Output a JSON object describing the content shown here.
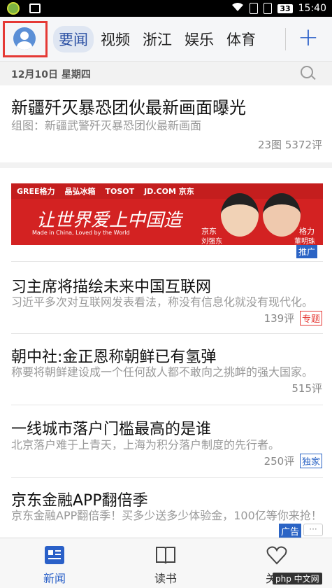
{
  "status_bar": {
    "battery": "33",
    "time": "15:40"
  },
  "tabs": [
    "要闻",
    "视频",
    "浙江",
    "娱乐",
    "体育"
  ],
  "date_line": "12月10日 星期四",
  "featured": {
    "title": "新疆歼灭暴恐团伙最新画面曝光",
    "subtitle": "组图：新疆武警歼灭暴恐团伙最新画面",
    "meta": "23图  5372评"
  },
  "ad": {
    "brands": [
      "GREE格力",
      "晶弘冰箱",
      "TOSOT",
      "JD.COM 京东"
    ],
    "slogan": "让世界爱上中国造",
    "tagline": "Made in China, Loved by the World",
    "person1_title": "京东",
    "person1_name": "刘强东",
    "person2_title": "格力",
    "person2_name": "董明珠",
    "tag": "推广"
  },
  "news": [
    {
      "title": "习主席将描绘未来中国互联网",
      "summary": "习近平多次对互联网发表看法，称没有信息化就没有现代化。",
      "comments": "139评",
      "badge": "专题"
    },
    {
      "title": "朝中社:金正恩称朝鲜已有氢弹",
      "summary": "称要将朝鲜建设成一个任何敌人都不敢向之挑衅的强大国家。",
      "comments": "515评",
      "badge": ""
    },
    {
      "title": "一线城市落户门槛最高的是谁",
      "summary": "北京落户难于上青天，上海为积分落户制度的先行者。",
      "comments": "250评",
      "badge": "独家"
    },
    {
      "title": "京东金融APP翻倍季",
      "summary": "京东金融APP翻倍季！买多少送多少体验金，100亿等你来抢！",
      "comments": "",
      "badge": "广告"
    }
  ],
  "bottom_nav": [
    "新闻",
    "读书",
    "关心"
  ],
  "watermark": "php 中文网",
  "colors": {
    "accent": "#2a60c8",
    "highlight_box": "#e53935",
    "ad_red": "#d32222"
  }
}
